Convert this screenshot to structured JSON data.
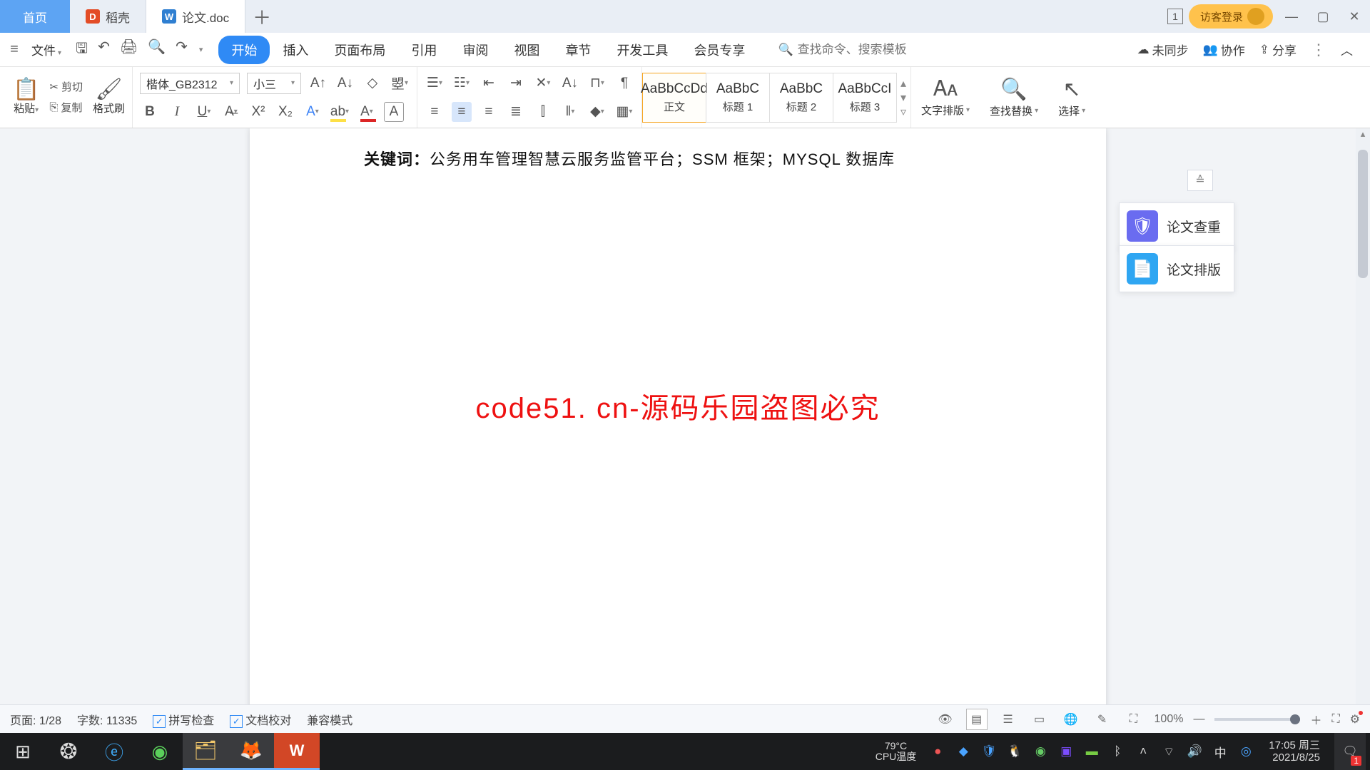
{
  "tabs": {
    "home": "首页",
    "daoke": "稻壳",
    "doc": "论文.doc"
  },
  "titlebar": {
    "count": "1",
    "login": "访客登录"
  },
  "menu": {
    "file": "文件",
    "items": [
      "开始",
      "插入",
      "页面布局",
      "引用",
      "审阅",
      "视图",
      "章节",
      "开发工具",
      "会员专享"
    ],
    "search_ph": "查找命令、搜索模板",
    "sync": "未同步",
    "collab": "协作",
    "share": "分享"
  },
  "ribbon": {
    "paste": "粘贴",
    "cut": "剪切",
    "copy": "复制",
    "brush": "格式刷",
    "font": "楷体_GB2312",
    "size": "小三",
    "styles": [
      {
        "prev": "AaBbCcDd",
        "name": "正文"
      },
      {
        "prev": "AaBbC",
        "name": "标题 1"
      },
      {
        "prev": "AaBbC",
        "name": "标题 2"
      },
      {
        "prev": "AaBbCcI",
        "name": "标题 3"
      }
    ],
    "text_layout": "文字排版",
    "find": "查找替换",
    "select": "选择"
  },
  "doc": {
    "kw_label": "关键词：",
    "kw_body": "公务用车管理智慧云服务监管平台；SSM 框架；MYSQL 数据库",
    "banner": "code51. cn-源码乐园盗图必究"
  },
  "side": {
    "check": "论文查重",
    "layout": "论文排版"
  },
  "status": {
    "page_lbl": "页面:",
    "page_val": "1/28",
    "words_lbl": "字数:",
    "words_val": "11335",
    "spell": "拼写检查",
    "proof": "文档校对",
    "compat": "兼容模式",
    "zoom": "100%"
  },
  "tray": {
    "cpu_lbl": "CPU温度",
    "cpu_val": "79°C",
    "ime": "中",
    "time": "17:05",
    "day": "周三",
    "date": "2021/8/25",
    "notif": "1"
  },
  "wm": "code51.cn"
}
